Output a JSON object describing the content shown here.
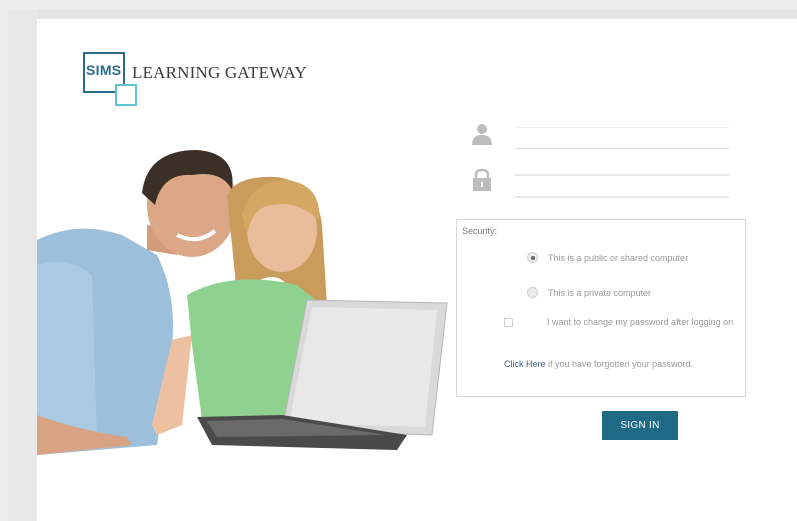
{
  "logo": {
    "sims": "SIMS",
    "product": "LEARNING GATEWAY"
  },
  "form": {
    "username_placeholder": "",
    "password_placeholder": "",
    "security": {
      "title": "Security:",
      "option_public": "This is a public or shared computer",
      "option_private": "This is a private computer",
      "change_password": "I want to change my password after logging on",
      "forgot_link": "Click Here",
      "forgot_text": " if you have forgotten your password."
    },
    "signin_label": "SIGN IN"
  },
  "colors": {
    "brand_dark": "#2a6b8a",
    "brand_light": "#5fc3d4",
    "button": "#1f6b87",
    "link": "#3b5f86"
  }
}
